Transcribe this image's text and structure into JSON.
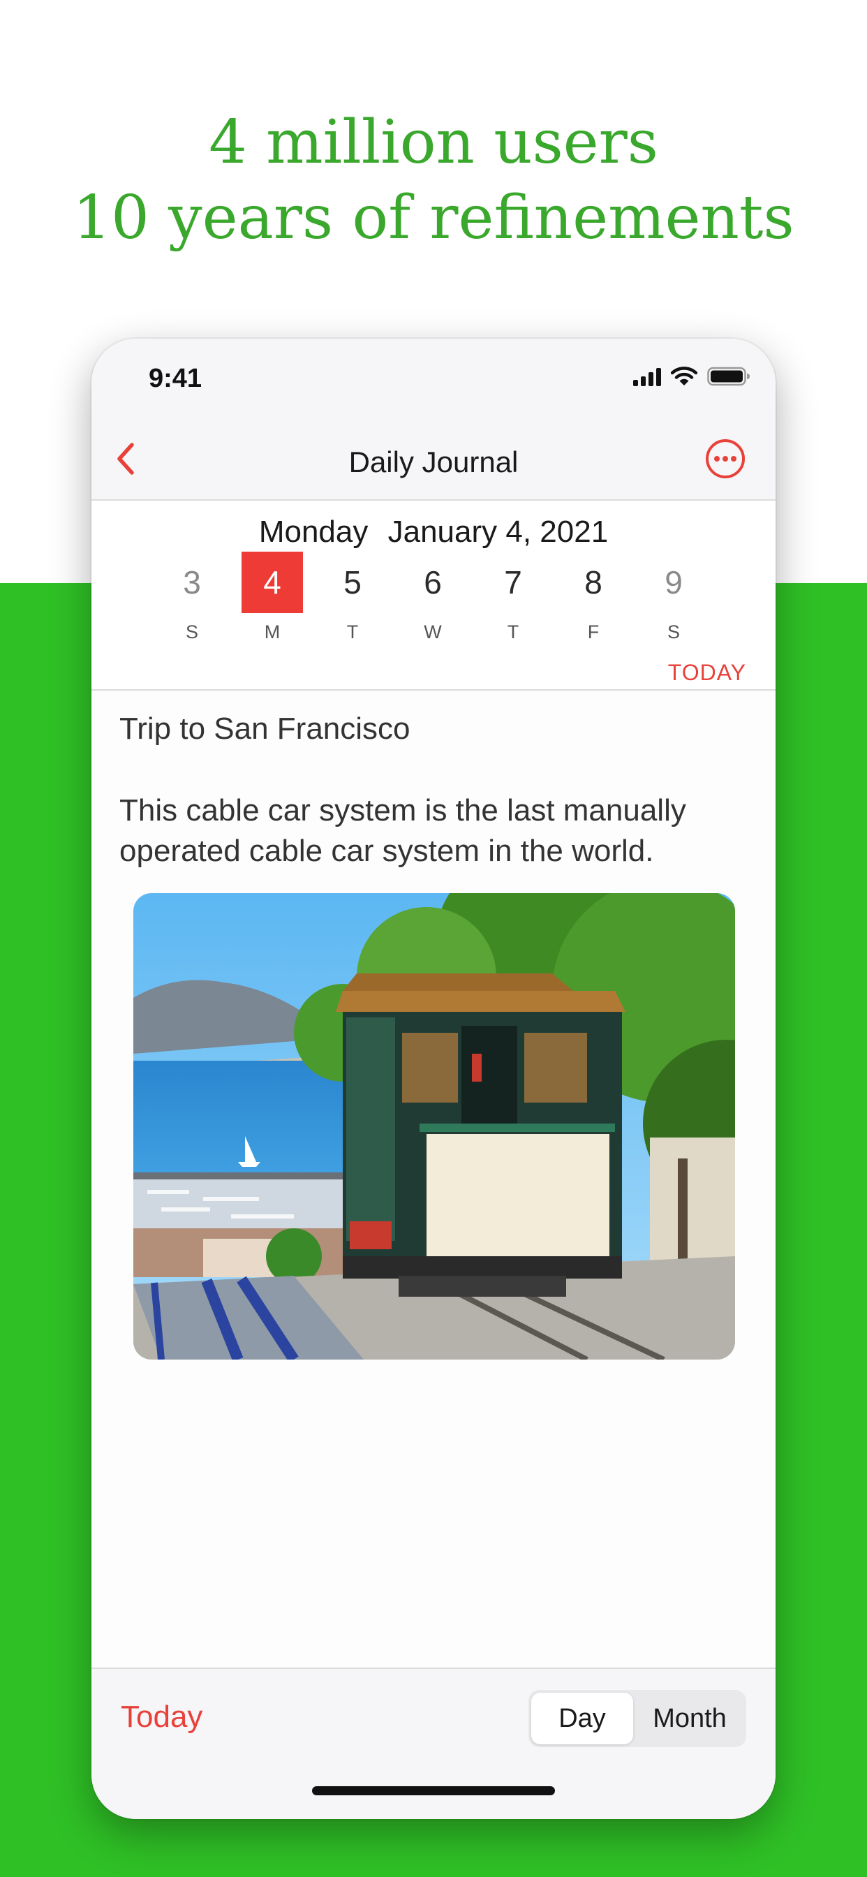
{
  "headline": {
    "line1": "4 million users",
    "line2": "10 years of refinements"
  },
  "status_bar": {
    "time": "9:41",
    "icons": [
      "cellular-signal-icon",
      "wifi-icon",
      "battery-icon"
    ]
  },
  "nav": {
    "title": "Daily Journal",
    "back_icon": "chevron-left-icon",
    "more_icon": "ellipsis-circle-icon"
  },
  "date_header": {
    "weekday": "Monday",
    "date": "January 4, 2021"
  },
  "week": [
    {
      "num": "3",
      "label": "S"
    },
    {
      "num": "4",
      "label": "M"
    },
    {
      "num": "5",
      "label": "T"
    },
    {
      "num": "6",
      "label": "W"
    },
    {
      "num": "7",
      "label": "T"
    },
    {
      "num": "8",
      "label": "F"
    },
    {
      "num": "9",
      "label": "S"
    }
  ],
  "selected_day": "4",
  "today_link": "TODAY",
  "entry": {
    "title": "Trip to San Francisco",
    "body": "This cable car system is the last manually operated cable car system in the world."
  },
  "bottom_bar": {
    "today": "Today",
    "segments": [
      "Day",
      "Month"
    ],
    "selected_segment": "Day"
  },
  "colors": {
    "accent_red": "#e8413a",
    "selected_day_bg": "#ef3b36",
    "promo_green": "#2fc026",
    "headline_green": "#3aa82c"
  }
}
